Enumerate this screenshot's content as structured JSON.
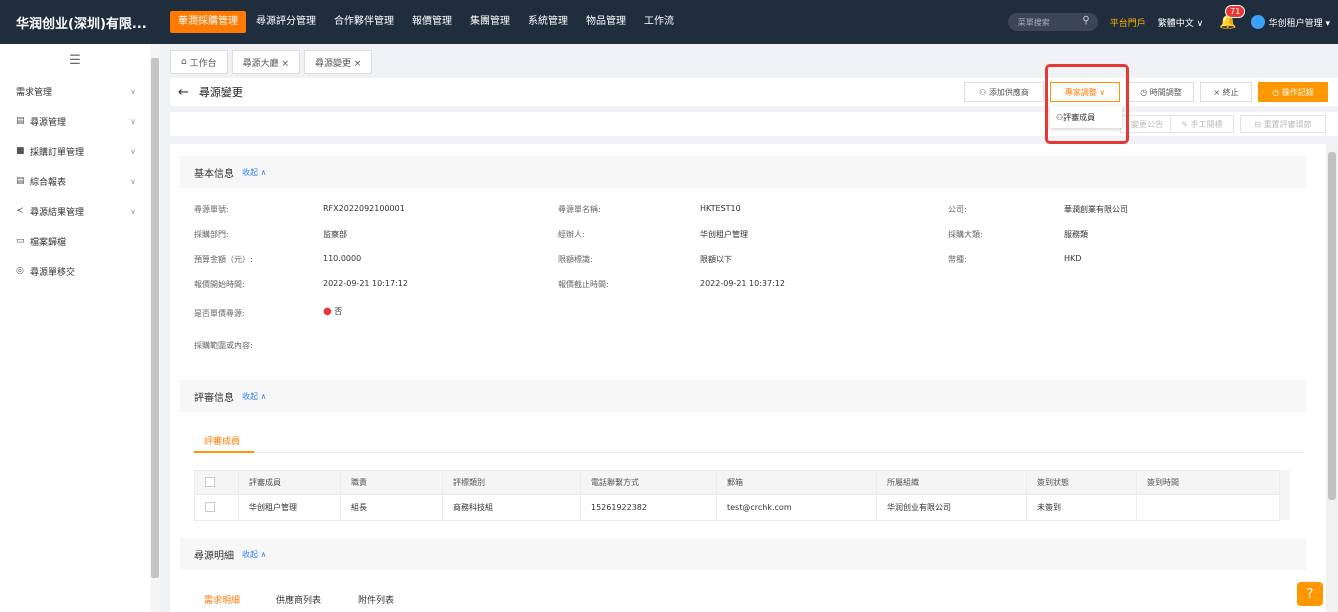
{
  "topbar": {
    "brand": "华润创业(深圳)有限...",
    "nav": [
      "華潤採購管理",
      "尋源評分管理",
      "合作夥伴管理",
      "報價管理",
      "集團管理",
      "系統管理",
      "物品管理",
      "工作流"
    ],
    "search_placeholder": "菜單搜索",
    "portal": "平台門戶",
    "language": "繁體中文 ∨",
    "notifications": "71",
    "user": "华创租户管理 ▾"
  },
  "sidebar": {
    "items": [
      {
        "label": "需求管理"
      },
      {
        "label": "尋源管理"
      },
      {
        "label": "採購訂單管理"
      },
      {
        "label": "綜合報表"
      },
      {
        "label": "尋源結果管理"
      },
      {
        "label": "檔案歸檔"
      },
      {
        "label": "尋源單移交"
      }
    ]
  },
  "tabs": [
    "工作台",
    "尋源大廳 ×",
    "尋源變更 ×"
  ],
  "page": {
    "title": "尋源變更",
    "actions": {
      "add_supplier": "添加供應商",
      "expert_adjust": "專家調整",
      "time_adjust": "時間調整",
      "terminate": "終止",
      "op_log": "操作記錄"
    },
    "subactions": {
      "notice": "變更公告",
      "manual_bid": "手工開標",
      "reset_review": "重置評審環節"
    },
    "dropdown_item": "評審成員"
  },
  "basic": {
    "title": "基本信息",
    "toggle": "收起 ∧",
    "fields": {
      "rfx_no_label": "尋源單號:",
      "rfx_no": "RFX2022092100001",
      "rfx_name_label": "尋源單名稱:",
      "rfx_name": "HKTEST10",
      "company_label": "公司:",
      "company": "華潤創業有限公司",
      "dept_label": "採購部門:",
      "dept": "监察部",
      "handler_label": "經辦人:",
      "handler": "华创租户管理",
      "category_label": "採購大類:",
      "category": "服務類",
      "budget_label": "預算金額（元）:",
      "budget": "110.0000",
      "limit_label": "限額標識:",
      "limit": "限額以下",
      "currency_label": "幣種:",
      "currency": "HKD",
      "quote_start_label": "報價開始時間:",
      "quote_start": "2022-09-21 10:17:12",
      "quote_end_label": "報價截止時間:",
      "quote_end": "2022-09-21 10:37:12",
      "single_label": "是否單價尋源:",
      "single": "否",
      "scope_label": "採購範圍或內容:"
    }
  },
  "review": {
    "title": "評審信息",
    "toggle": "收起 ∧",
    "tab": "評審成員",
    "columns": [
      "評審成員",
      "職責",
      "評標類別",
      "電話聯繫方式",
      "郵箱",
      "所屬組織",
      "簽到狀態",
      "簽到時間"
    ],
    "rows": [
      [
        "华创租户管理",
        "組長",
        "商務科技組",
        "15261922382",
        "test@crchk.com",
        "华润创业有限公司",
        "未簽到",
        ""
      ]
    ]
  },
  "detail": {
    "title": "尋源明細",
    "toggle": "收起 ∧",
    "tabs": [
      "需求明細",
      "供應商列表",
      "附件列表"
    ]
  },
  "colors": {
    "topbar": "#1f2d3d",
    "accent": "#ff9800",
    "highlight": "#e53935",
    "link": "#2e7df6"
  }
}
